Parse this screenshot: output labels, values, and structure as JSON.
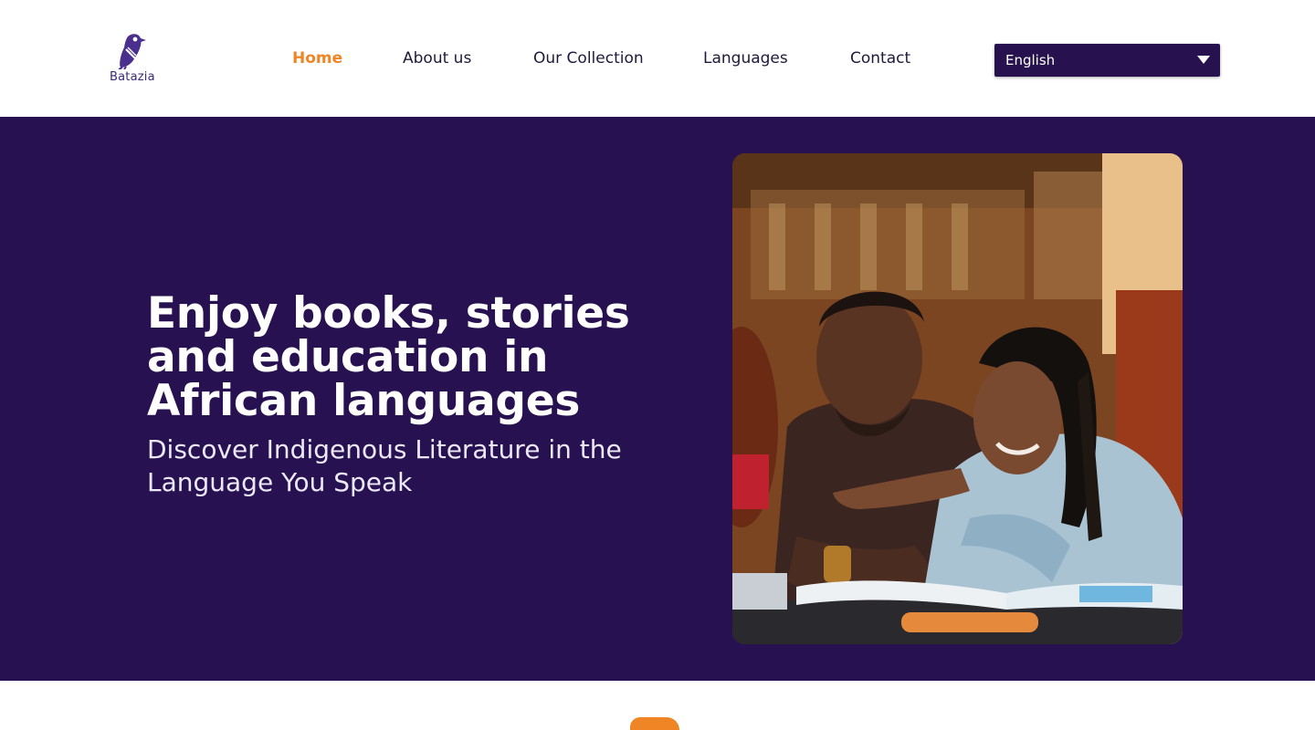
{
  "header": {
    "logo_text": "Batazia",
    "nav": [
      {
        "label": "Home",
        "active": true
      },
      {
        "label": "About us",
        "active": false
      },
      {
        "label": "Our Collection",
        "active": false
      },
      {
        "label": "Languages",
        "active": false
      },
      {
        "label": "Contact",
        "active": false
      }
    ],
    "language_select": {
      "value": "English"
    }
  },
  "hero": {
    "title": "Enjoy books, stories and education in African languages",
    "subtitle": "Discover Indigenous Literature in the Language You Speak"
  },
  "colors": {
    "brand_dark": "#271151",
    "accent": "#f08525",
    "logo": "#3b2a7a"
  },
  "icons": [
    "bird-logo-icon",
    "chevron-down-icon"
  ]
}
